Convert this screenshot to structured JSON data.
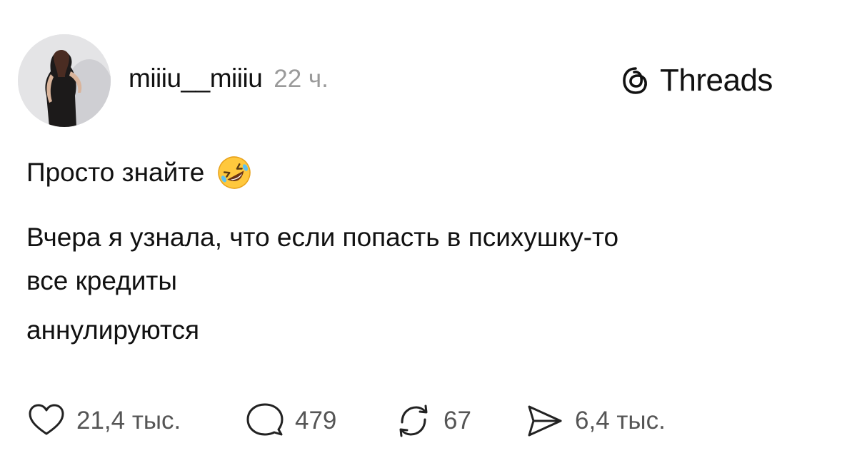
{
  "post": {
    "username": "miiiu__miiiu",
    "timestamp": "22 ч.",
    "text_lines": [
      "Просто знайте",
      "Вчера я узнала, что если попасть в психушку-то",
      "все кредиты",
      "аннулируются"
    ],
    "emoji_name": "rolling-on-the-floor-laughing"
  },
  "brand": {
    "name": "Threads",
    "icon": "threads-logo-icon"
  },
  "actions": {
    "likes": {
      "icon": "heart-icon",
      "count": "21,4 тыс."
    },
    "replies": {
      "icon": "comment-icon",
      "count": "479"
    },
    "reposts": {
      "icon": "repost-icon",
      "count": "67"
    },
    "shares": {
      "icon": "share-icon",
      "count": "6,4 тыс."
    }
  },
  "colors": {
    "text": "#111111",
    "muted": "#9a9a9a",
    "count": "#555555",
    "background": "#ffffff"
  }
}
